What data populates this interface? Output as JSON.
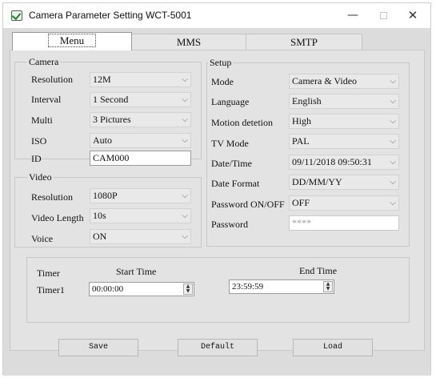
{
  "window": {
    "title": "Camera Parameter Setting WCT-5001",
    "minimize_glyph": "—",
    "close_glyph": "✕"
  },
  "tabs": [
    "Menu",
    "MMS",
    "SMTP"
  ],
  "camera": {
    "title": "Camera",
    "resolution_label": "Resolution",
    "resolution": "12M",
    "interval_label": "Interval",
    "interval": "1 Second",
    "multi_label": "Multi",
    "multi": "3 Pictures",
    "iso_label": "ISO",
    "iso": "Auto",
    "id_label": "ID",
    "id": "CAM000"
  },
  "video": {
    "title": "Video",
    "resolution_label": "Resolution",
    "resolution": "1080P",
    "length_label": "Video Length",
    "length": "10s",
    "voice_label": "Voice",
    "voice": "ON"
  },
  "setup": {
    "title": "Setup",
    "mode_label": "Mode",
    "mode": "Camera & Video",
    "language_label": "Language",
    "language": "English",
    "motion_label": "Motion detetion",
    "motion": "High",
    "tv_label": "TV Mode",
    "tv": "PAL",
    "datetime_label": "Date/Time",
    "datetime": "09/11/2018 09:50:31",
    "dateformat_label": "Date Format",
    "dateformat": "DD/MM/YY",
    "password_onoff_label": "Password ON/OFF",
    "password_onoff": "OFF",
    "password_label": "Password",
    "password": "****"
  },
  "timer": {
    "title": "Timer",
    "start_label": "Start Time",
    "end_label": "End Time",
    "timer1_label": "Timer1",
    "timer1_start": "00:00:00",
    "timer1_end": "23:59:59"
  },
  "buttons": {
    "save": "Save",
    "default": "Default",
    "load": "Load"
  },
  "icons": {
    "dropdown": "chevron-down-icon",
    "spinner": "spin-updown-icon",
    "app": "checkbox-app-icon"
  },
  "colors": {
    "panel": "#e3e3e3",
    "client": "#dcdcdc",
    "app_icon": "#2e7d32"
  }
}
